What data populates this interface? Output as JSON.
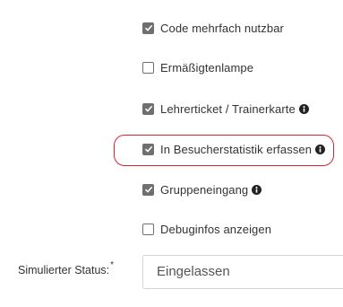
{
  "options": [
    {
      "label": "Code mehrfach nutzbar",
      "checked": true,
      "info": false
    },
    {
      "label": "Ermäßigtenlampe",
      "checked": false,
      "info": false
    },
    {
      "label": "Lehrerticket / Trainerkarte",
      "checked": true,
      "info": true
    },
    {
      "label": "In Besucherstatistik erfassen",
      "checked": true,
      "info": true,
      "highlighted": true
    },
    {
      "label": "Gruppeneingang",
      "checked": true,
      "info": true
    },
    {
      "label": "Debuginfos anzeigen",
      "checked": false,
      "info": false
    }
  ],
  "status": {
    "label": "Simulierter Status:",
    "required_marker": "*",
    "value": "Eingelassen"
  },
  "colors": {
    "checkbox_checked": "#6f6f6f",
    "highlight_outline": "#d9232d",
    "text": "#333333"
  }
}
